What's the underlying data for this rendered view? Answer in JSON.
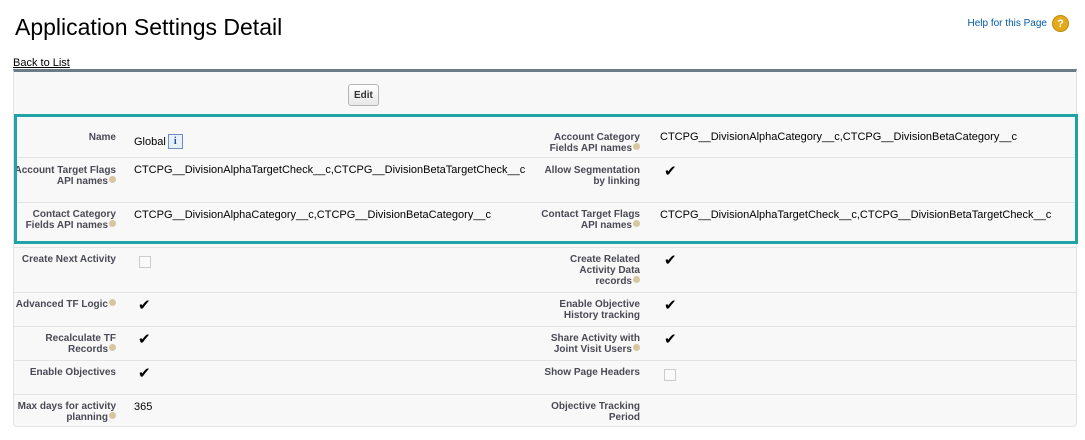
{
  "header": {
    "title": "Application Settings Detail",
    "help_label": "Help for this Page",
    "help_icon": "question-circle-icon",
    "back_link": "Back to List"
  },
  "toolbar": {
    "edit_label": "Edit"
  },
  "colors": {
    "highlight": "#1fa3a6",
    "link": "#015ba7",
    "panel_border": "#6b7b88"
  },
  "rows": [
    {
      "left": {
        "label": "Name",
        "value": "Global",
        "info_icon": "i"
      },
      "right": {
        "label": "Account Category Fields API names",
        "value": "CTCPG__DivisionAlphaCategory__c,CTCPG__DivisionBetaCategory__c"
      }
    },
    {
      "left": {
        "label": "Account Target Flags API names",
        "value": "CTCPG__DivisionAlphaTargetCheck__c,CTCPG__DivisionBetaTargetCheck__c"
      },
      "right": {
        "label": "Allow Segmentation by linking",
        "checked": true,
        "mark": "✔"
      }
    },
    {
      "left": {
        "label": "Contact Category Fields API names",
        "value": "CTCPG__DivisionAlphaCategory__c,CTCPG__DivisionBetaCategory__c"
      },
      "right": {
        "label": "Contact Target Flags API names",
        "value": "CTCPG__DivisionAlphaTargetCheck__c,CTCPG__DivisionBetaTargetCheck__c"
      }
    },
    {
      "left": {
        "label": "Create Next Activity",
        "checked": false
      },
      "right": {
        "label": "Create Related Activity Data records",
        "checked": true,
        "mark": "✔"
      }
    },
    {
      "left": {
        "label": "Advanced TF Logic",
        "checked": true,
        "mark": "✔"
      },
      "right": {
        "label": "Enable Objective History tracking",
        "checked": true,
        "mark": "✔"
      }
    },
    {
      "left": {
        "label": "Recalculate TF Records",
        "checked": true,
        "mark": "✔"
      },
      "right": {
        "label": "Share Activity with Joint Visit Users",
        "checked": true,
        "mark": "✔"
      }
    },
    {
      "left": {
        "label": "Enable Objectives",
        "checked": true,
        "mark": "✔"
      },
      "right": {
        "label": "Show Page Headers",
        "checked": false
      }
    },
    {
      "left": {
        "label": "Max days for activity planning",
        "value": "365"
      },
      "right": {
        "label": "Objective Tracking Period",
        "value": ""
      }
    }
  ]
}
